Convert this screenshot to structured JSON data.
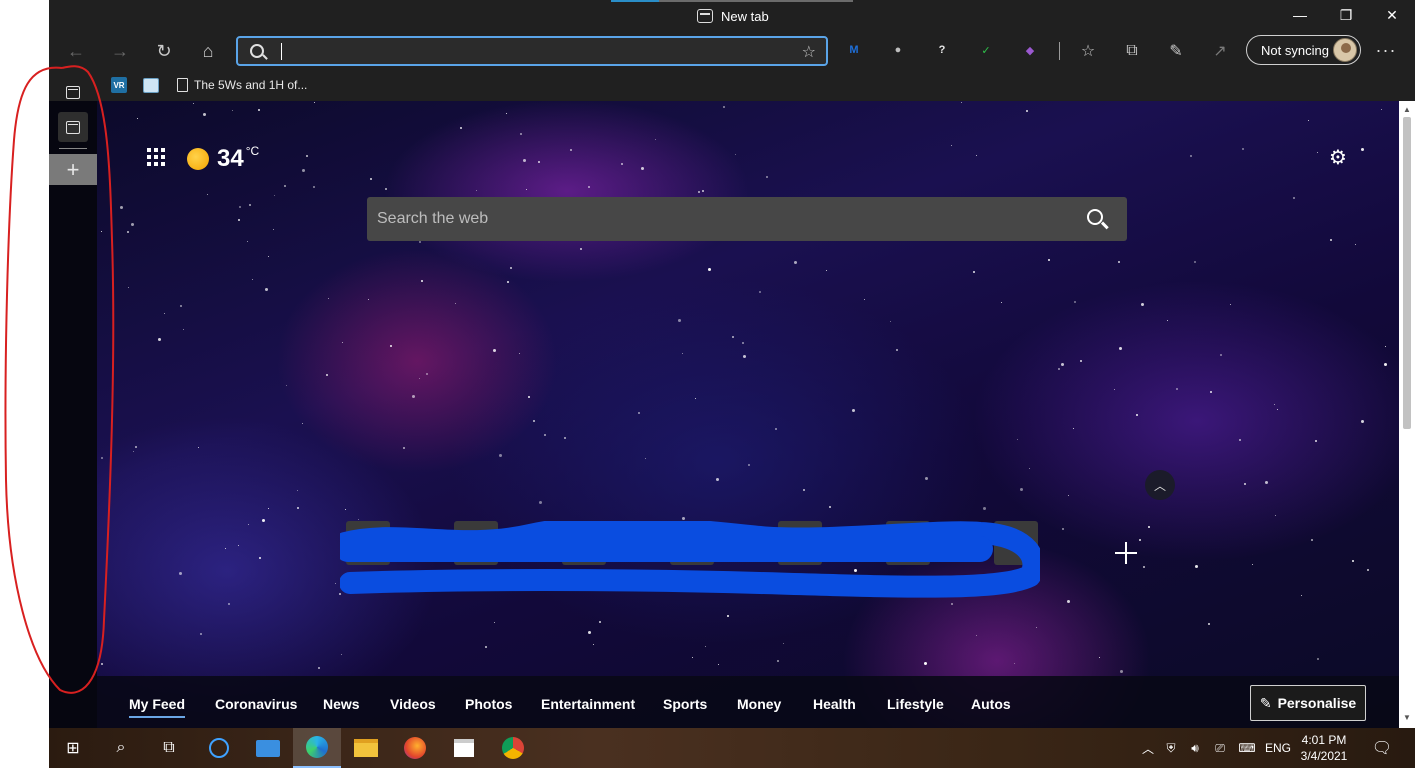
{
  "window": {
    "tab_title": "New tab",
    "minimize": "—",
    "restore": "❐",
    "close": "✕"
  },
  "toolbar": {
    "back": "←",
    "forward": "→",
    "refresh": "↻",
    "home": "⌂",
    "address_value": "",
    "address_placeholder": "",
    "sync_label": "Not syncing",
    "more": "···",
    "extensions": [
      {
        "name": "malwarebytes-extension-icon",
        "glyph": "M",
        "color": "#1e6fd9"
      },
      {
        "name": "circle-extension-icon",
        "glyph": "●",
        "color": "#bdbdbd"
      },
      {
        "name": "help-extension-icon",
        "glyph": "?",
        "color": "#e8e8e8"
      },
      {
        "name": "check-extension-icon",
        "glyph": "✓",
        "color": "#2ec04a"
      },
      {
        "name": "cube-extension-icon",
        "glyph": "◆",
        "color": "#9b59d0"
      }
    ]
  },
  "bookmarks": [
    {
      "label": ""
    },
    {
      "label": ""
    },
    {
      "label": "The 5Ws and 1H of..."
    }
  ],
  "vertical_tabs": {
    "add": "+"
  },
  "page": {
    "temperature": "34",
    "temp_unit": "°C",
    "search_placeholder": "Search the web",
    "feed_tabs": [
      "My Feed",
      "Coronavirus",
      "News",
      "Videos",
      "Photos",
      "Entertainment",
      "Sports",
      "Money",
      "Health",
      "Lifestyle",
      "Autos"
    ],
    "personalise": "Personalise"
  },
  "taskbar": {
    "language": "ENG",
    "time": "4:01 PM",
    "date": "3/4/2021"
  },
  "colors": {
    "annotation_red": "#d82020",
    "scribble_blue": "#0a4de0",
    "accent": "#5aa4e8"
  }
}
